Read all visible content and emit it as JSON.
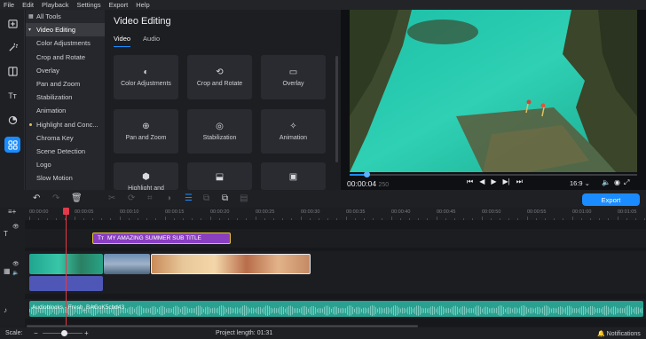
{
  "menu": [
    "File",
    "Edit",
    "Playback",
    "Settings",
    "Export",
    "Help"
  ],
  "sidebar": [
    {
      "name": "import-icon",
      "glyph": "⊞"
    },
    {
      "name": "magic-wand-icon",
      "glyph": "✦"
    },
    {
      "name": "transitions-icon",
      "glyph": "◫"
    },
    {
      "name": "titles-icon",
      "glyph": "Tт"
    },
    {
      "name": "stickers-icon",
      "glyph": "◔"
    },
    {
      "name": "more-tools-icon",
      "glyph": "⊞"
    }
  ],
  "categories": {
    "items": [
      "All Tools",
      "Video Editing",
      "Color Adjustments",
      "Crop and Rotate",
      "Overlay",
      "Pan and Zoom",
      "Stabilization",
      "Animation",
      "Highlight and Conc...",
      "Chroma Key",
      "Scene Detection",
      "Logo",
      "Slow Motion"
    ],
    "selected_index": 1,
    "expanded_index": 1,
    "dot_index": 8
  },
  "panel": {
    "title": "Video Editing",
    "tabs": [
      "Video",
      "Audio"
    ],
    "active_tab": 0,
    "tiles": [
      {
        "label": "Color Adjustments",
        "icon": "color-adjust-icon",
        "glyph": "◐"
      },
      {
        "label": "Crop and Rotate",
        "icon": "crop-rotate-icon",
        "glyph": "⟲"
      },
      {
        "label": "Overlay",
        "icon": "overlay-icon",
        "glyph": "▭"
      },
      {
        "label": "Pan and Zoom",
        "icon": "pan-zoom-icon",
        "glyph": "⊕"
      },
      {
        "label": "Stabilization",
        "icon": "stabilization-icon",
        "glyph": "◎"
      },
      {
        "label": "Animation",
        "icon": "animation-icon",
        "glyph": "✧"
      },
      {
        "label": "Highlight and",
        "icon": "highlight-icon",
        "glyph": "⬢"
      },
      {
        "label": "",
        "icon": "logo-icon",
        "glyph": "⬓"
      },
      {
        "label": "",
        "icon": "slow-motion-icon",
        "glyph": "▣"
      }
    ]
  },
  "player": {
    "timecode": "00:00:04",
    "frame": "250",
    "progress": 0.06,
    "aspect": "16:9 ⌄",
    "controls": [
      "⏮",
      "◀",
      "▶",
      "▶|",
      "⏭"
    ]
  },
  "toolbar": {
    "export_label": "Export"
  },
  "ruler": [
    "00:00:00",
    "00:00:05",
    "00:00:10",
    "00:00:15",
    "00:00:20",
    "00:00:25",
    "00:00:30",
    "00:00:35",
    "00:00:40",
    "00:00:45",
    "00:00:50",
    "00:00:55",
    "00:01:00",
    "00:01:05"
  ],
  "timeline": {
    "title_clip": "MY AMAZING SUMMER SUB TITLE",
    "music_clip": "Audioblocks - Fresh_BAGoK5cbd43"
  },
  "status": {
    "scale_label": "Scale:",
    "project_length": "Project length:  01:31",
    "notifications": "Notifications"
  },
  "colors": {
    "accent": "#1a8cff",
    "title_clip": "#8a3fbf",
    "music": "#2aa190",
    "audio": "#4e57b5",
    "playhead": "#e23a4a"
  }
}
